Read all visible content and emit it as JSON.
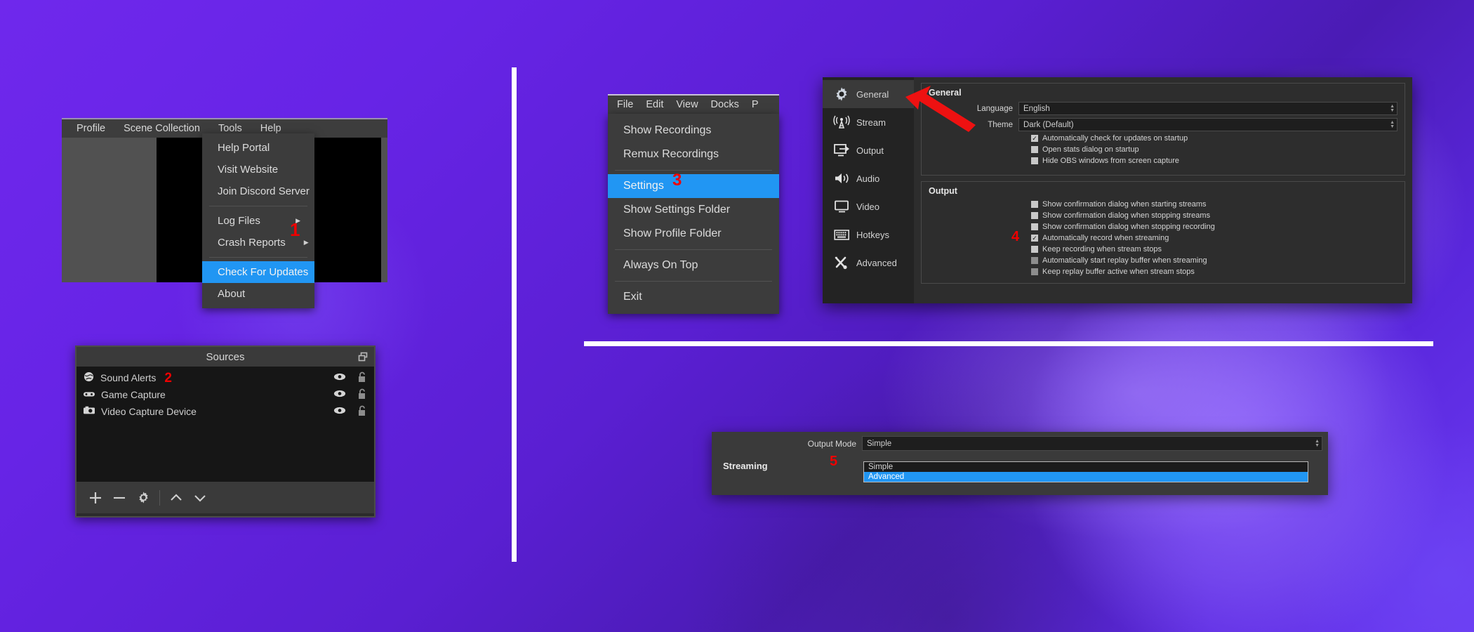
{
  "background": {
    "accent_purple": "#6f28ec",
    "divider_color": "#ffffff",
    "highlight_blue": "#2196f3",
    "marker_red": "#f00000"
  },
  "obs_main": {
    "menubar": [
      "Profile",
      "Scene Collection",
      "Tools",
      "Help"
    ],
    "help_menu": {
      "items": [
        {
          "label": "Help Portal",
          "submenu": false,
          "selected": false
        },
        {
          "label": "Visit Website",
          "submenu": false,
          "selected": false
        },
        {
          "label": "Join Discord Server",
          "submenu": false,
          "selected": false
        },
        {
          "label": "Log Files",
          "submenu": true,
          "selected": false
        },
        {
          "label": "Crash Reports",
          "submenu": true,
          "selected": false
        },
        {
          "label": "Check For Updates",
          "submenu": false,
          "selected": true
        },
        {
          "label": "About",
          "submenu": false,
          "selected": false
        }
      ],
      "separator_after": [
        2,
        4
      ],
      "step_marker": "1"
    }
  },
  "sources_dock": {
    "title": "Sources",
    "popout_icon": "popout-icon",
    "step_marker": "2",
    "items": [
      {
        "icon": "globe-icon",
        "label": "Sound Alerts",
        "marker": "2",
        "eye": "eye-icon",
        "lock": "unlock-icon"
      },
      {
        "icon": "gamepad-icon",
        "label": "Game Capture",
        "marker": "",
        "eye": "eye-icon",
        "lock": "unlock-icon"
      },
      {
        "icon": "camera-icon",
        "label": "Video Capture Device",
        "marker": "",
        "eye": "eye-icon",
        "lock": "unlock-icon"
      }
    ],
    "toolbar": [
      {
        "name": "add-source-button",
        "glyph": "+"
      },
      {
        "name": "remove-source-button",
        "glyph": "−"
      },
      {
        "name": "source-properties-button",
        "glyph": "gear-icon"
      },
      {
        "name": "move-source-up-button",
        "glyph": "∧"
      },
      {
        "name": "move-source-down-button",
        "glyph": "∨"
      }
    ]
  },
  "file_window": {
    "menubar": [
      "File",
      "Edit",
      "View",
      "Docks",
      "P"
    ],
    "file_menu": {
      "items": [
        {
          "label": "Show Recordings",
          "selected": false
        },
        {
          "label": "Remux Recordings",
          "selected": false
        },
        {
          "label": "Settings",
          "selected": true
        },
        {
          "label": "Show Settings Folder",
          "selected": false
        },
        {
          "label": "Show Profile Folder",
          "selected": false
        },
        {
          "label": "Always On Top",
          "selected": false
        },
        {
          "label": "Exit",
          "selected": false
        }
      ],
      "separator_after": [
        1,
        4,
        5
      ],
      "step_marker": "3"
    }
  },
  "settings_dialog": {
    "sidebar": [
      {
        "label": "General",
        "icon": "gear-icon",
        "active": true
      },
      {
        "label": "Stream",
        "icon": "broadcast-icon",
        "active": false
      },
      {
        "label": "Output",
        "icon": "output-monitor-icon",
        "active": false
      },
      {
        "label": "Audio",
        "icon": "speaker-icon",
        "active": false
      },
      {
        "label": "Video",
        "icon": "monitor-icon",
        "active": false
      },
      {
        "label": "Hotkeys",
        "icon": "keyboard-icon",
        "active": false
      },
      {
        "label": "Advanced",
        "icon": "tools-icon",
        "active": false
      }
    ],
    "pointer_icon": "red-arrow-icon",
    "general_group": {
      "title": "General",
      "fields": [
        {
          "label": "Language",
          "value": "English"
        },
        {
          "label": "Theme",
          "value": "Dark (Default)"
        }
      ],
      "checkboxes": [
        {
          "label": "Automatically check for updates on startup",
          "checked": true,
          "dim": false
        },
        {
          "label": "Open stats dialog on startup",
          "checked": false,
          "dim": false
        },
        {
          "label": "Hide OBS windows from screen capture",
          "checked": false,
          "dim": false
        }
      ]
    },
    "output_group": {
      "title": "Output",
      "step_marker": "4",
      "checkboxes": [
        {
          "label": "Show confirmation dialog when starting streams",
          "checked": false,
          "dim": false,
          "marker": ""
        },
        {
          "label": "Show confirmation dialog when stopping streams",
          "checked": false,
          "dim": false,
          "marker": ""
        },
        {
          "label": "Show confirmation dialog when stopping recording",
          "checked": false,
          "dim": false,
          "marker": ""
        },
        {
          "label": "Automatically record when streaming",
          "checked": true,
          "dim": false,
          "marker": "4"
        },
        {
          "label": "Keep recording when stream stops",
          "checked": false,
          "dim": false,
          "marker": ""
        },
        {
          "label": "Automatically start replay buffer when streaming",
          "checked": false,
          "dim": true,
          "marker": ""
        },
        {
          "label": "Keep replay buffer active when stream stops",
          "checked": false,
          "dim": true,
          "marker": ""
        }
      ]
    }
  },
  "output_mode_popup": {
    "label": "Output Mode",
    "value": "Simple",
    "options": [
      {
        "label": "Simple",
        "selected": false
      },
      {
        "label": "Advanced",
        "selected": true
      }
    ],
    "section_label": "Streaming",
    "step_marker": "5"
  }
}
